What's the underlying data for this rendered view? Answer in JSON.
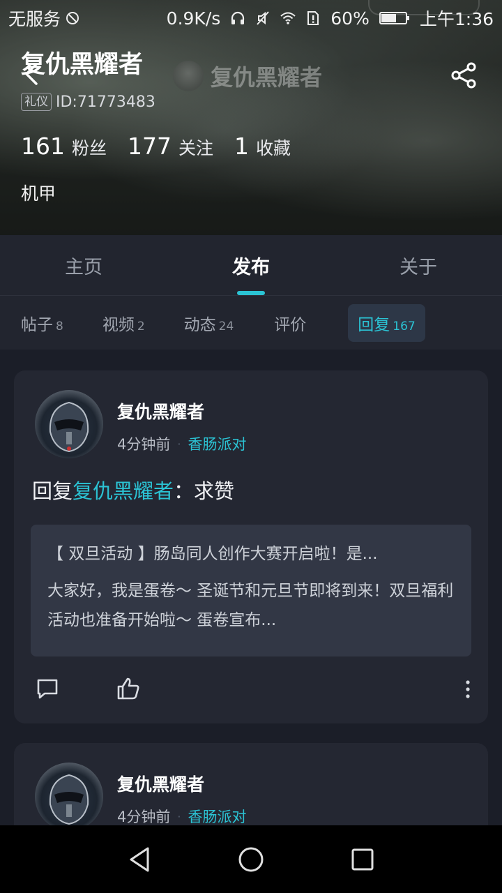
{
  "status_bar": {
    "carrier": "无服务",
    "net_speed": "0.9K/s",
    "battery": "60%",
    "time": "上午1:36"
  },
  "header": {
    "profile_name": "复仇黑耀者",
    "ghost_title": "复仇黑耀者",
    "badge": "礼仪",
    "id": "ID:71773483",
    "stats": [
      {
        "num": "161",
        "label": "粉丝"
      },
      {
        "num": "177",
        "label": "关注"
      },
      {
        "num": "1",
        "label": "收藏"
      }
    ],
    "tagline": "机甲"
  },
  "tabs": [
    {
      "label": "主页"
    },
    {
      "label": "发布"
    },
    {
      "label": "关于"
    }
  ],
  "subtabs": [
    {
      "label": "帖子",
      "count": "8"
    },
    {
      "label": "视频",
      "count": "2"
    },
    {
      "label": "动态",
      "count": "24"
    },
    {
      "label": "评价",
      "count": ""
    },
    {
      "label": "回复",
      "count": "167"
    }
  ],
  "posts": [
    {
      "author": "复仇黑耀者",
      "time": "4分钟前",
      "topic": "香肠派对",
      "reply_prefix": "回复",
      "reply_mention": "复仇黑耀者",
      "reply_text": "：求赞",
      "quote_title": "【 双旦活动 】肠岛同人创作大赛开启啦！是...",
      "quote_body": "大家好，我是蛋卷～ 圣诞节和元旦节即将到来！双旦福利活动也准备开始啦～ 蛋卷宣布..."
    },
    {
      "author": "复仇黑耀者",
      "time": "4分钟前",
      "topic": "香肠派对"
    }
  ],
  "colors": {
    "accent": "#2bc3d4",
    "background": "#1b1e28",
    "card": "#242732"
  }
}
